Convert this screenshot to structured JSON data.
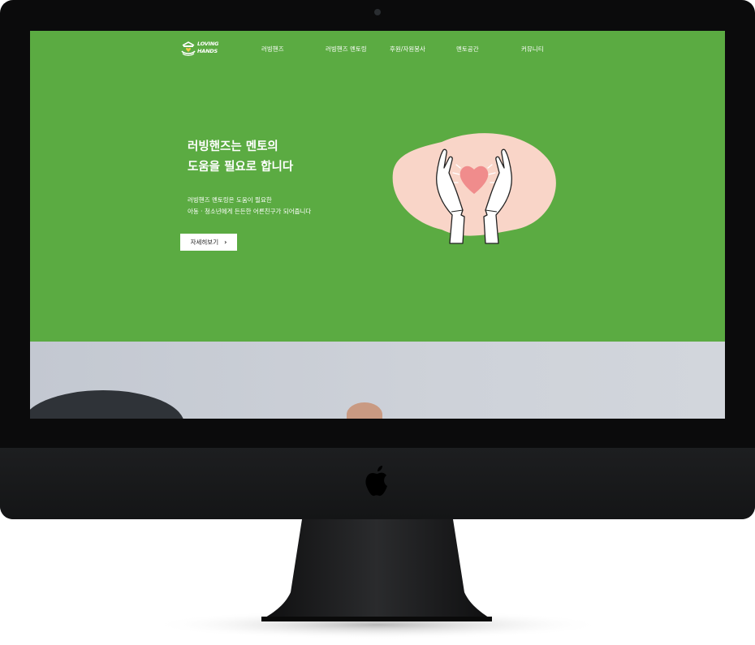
{
  "site": {
    "logo": {
      "line1": "LOVING",
      "line2": "HANDS"
    },
    "nav": [
      "러빙핸즈",
      "러빙핸즈 멘토링",
      "후원/자원봉사",
      "멘토공간",
      "커뮤니티"
    ]
  },
  "hero": {
    "title_line1": "러빙핸즈는 멘토의",
    "title_line2": "도움을 필요로 합니다",
    "desc_line1": "러빙핸즈 멘토링은 도움이 필요한",
    "desc_line2": "아동 · 청소년에게 든든한 어른친구가 되어줍니다",
    "button_label": "자세히보기",
    "button_icon": "chevron-right-icon",
    "illustration": "hands-heart-illustration"
  },
  "colors": {
    "brand_green": "#5bab42",
    "illustration_blob": "#f9d5c8",
    "heart": "#f08c8c",
    "monitor_body": "#0b0b0c"
  },
  "device": {
    "logo_icon": "apple-logo-icon"
  }
}
